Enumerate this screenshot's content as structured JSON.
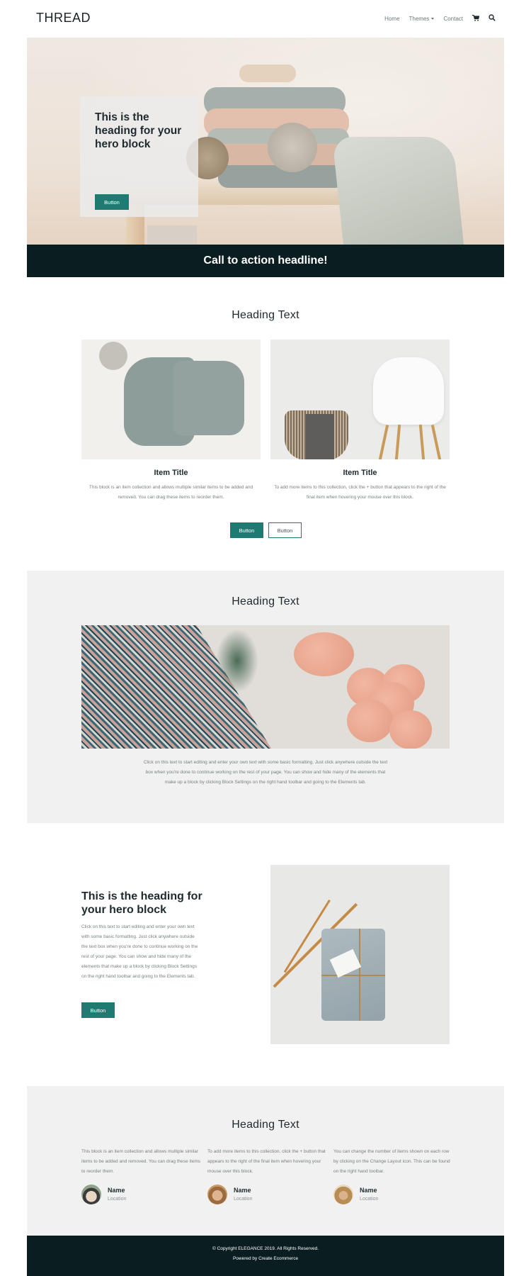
{
  "header": {
    "logo": "THREAD",
    "nav": [
      {
        "label": "Home"
      },
      {
        "label": "Themes",
        "has_dropdown": true
      },
      {
        "label": "Contact"
      }
    ],
    "icons": [
      "cart-icon",
      "search-icon"
    ]
  },
  "hero": {
    "title": "This is the heading for your hero block",
    "button_label": "Button"
  },
  "cta": {
    "headline": "Call to action headline!"
  },
  "collection": {
    "heading": "Heading Text",
    "items": [
      {
        "title": "Item Title",
        "description": "This block is an item collection and allows multiple similar items to be added and removed. You can drag these items to reorder them."
      },
      {
        "title": "Item Title",
        "description": "To add more items to this collection, click the + button that appears to the right of the final item when hovering your mouse over this block."
      }
    ],
    "buttons": {
      "primary": "Button",
      "secondary": "Button"
    }
  },
  "feature": {
    "heading": "Heading Text",
    "description": "Click on this text to start editing and enter your own text with some basic formatting. Just click anywhere outside the text box when you're done to continue working on the rest of your page. You can show and hide many of the elements that make up a block by clicking Block Settings on the right hand toolbar and going to the Elements tab."
  },
  "split": {
    "title": "This is the heading for your hero block",
    "description": "Click on this text to start editing and enter your own text with some basic formatting. Just click anywhere outside the text box when you're done to continue working on the rest of your page. You can show and hide many of the elements that make up a block by clicking Block Settings on the right hand toolbar and going to the Elements tab.",
    "button_label": "Button"
  },
  "testimonials": {
    "heading": "Heading Text",
    "items": [
      {
        "text": "This block is an item collection and allows multiple similar items to be added and removed. You can drag these items to reorder them.",
        "name": "Name",
        "location": "Location"
      },
      {
        "text": "To add more items to this collection, click the + button that appears to the right of the final item when hovering your mouse over this block.",
        "name": "Name",
        "location": "Location"
      },
      {
        "text": "You can change the number of items shown on each row by clicking on the Change Layout icon. This can be found on the right hand toolbar.",
        "name": "Name",
        "location": "Location"
      }
    ]
  },
  "footer": {
    "copyright": "© Copyright ELEGANCE 2019. All Rights Reserved.",
    "powered_by": "Powered by Create Ecommerce"
  },
  "colors": {
    "accent": "#1f7a72",
    "dark": "#0a1e22",
    "light_section": "#f1f1f1"
  }
}
